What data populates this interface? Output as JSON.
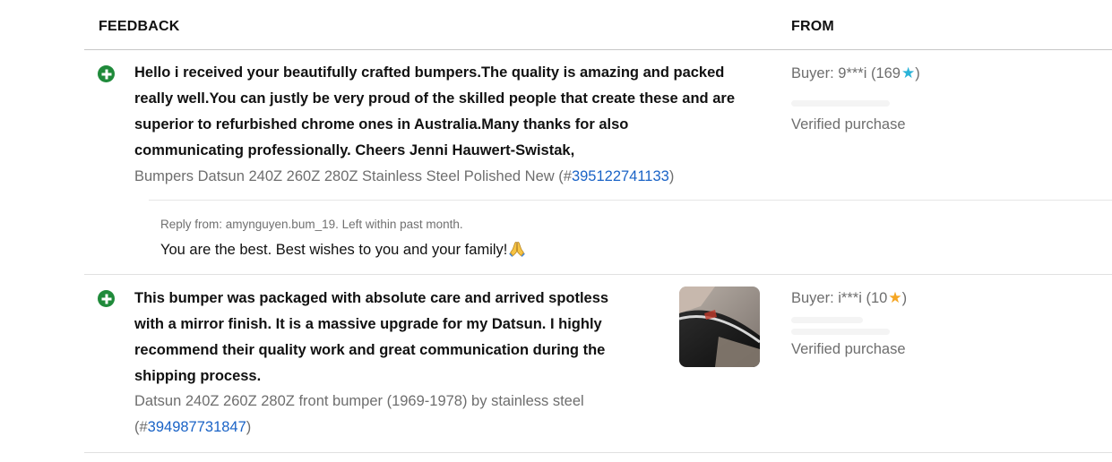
{
  "header": {
    "feedback_label": "FEEDBACK",
    "from_label": "FROM"
  },
  "feedback": [
    {
      "comment_lines": [
        "Hello i received your beautifully crafted bumpers.The quality is amazing and packed",
        "really well.You can justly be very proud of the skilled people that create these and are",
        "superior to refurbished chrome ones in Australia.Many thanks for also",
        "communicating professionally. Cheers Jenni Hauwert-Swistak,"
      ],
      "item_title": "Bumpers Datsun 240Z 260Z 280Z Stainless Steel Polished New",
      "item_number": "395122741133",
      "buyer": "Buyer: 9***i (169",
      "buyer_close": ")",
      "star_color": "#2ab3d8",
      "verified": "Verified purchase",
      "reply_meta": "Reply from: amynguyen.bum_19. Left within past month.",
      "reply_text": "You are the best. Best wishes to you and your family!",
      "reply_icon": "folded-hands-icon"
    },
    {
      "comment_lines": [
        "This bumper was packaged with absolute care and arrived spotless",
        "with a mirror finish. It is a massive upgrade for my Datsun. I highly",
        "recommend their quality work and great communication during the",
        "shipping process."
      ],
      "item_title": "Datsun 240Z 260Z 280Z front bumper (1969-1978) by stainless steel",
      "item_number": "394987731847",
      "buyer": "Buyer: i***i (10",
      "buyer_close": ")",
      "star_color": "#f5a623",
      "verified": "Verified purchase",
      "photo_icon": "feedback-photo-thumbnail"
    }
  ],
  "icons": {
    "positive": "plus-circle-icon",
    "star": "star-icon"
  }
}
